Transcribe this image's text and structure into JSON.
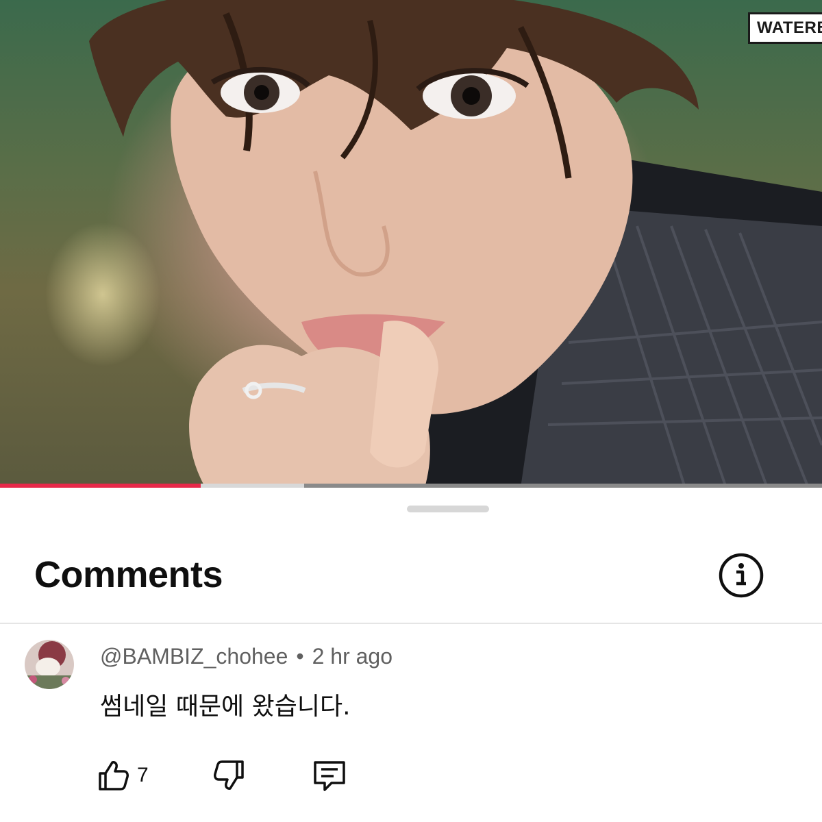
{
  "video": {
    "watermark": "WATERB",
    "progress": {
      "played_fraction": 0.244,
      "buffered_fraction": 0.37
    }
  },
  "comments_panel": {
    "title": "Comments",
    "info_icon": "info-circle-icon"
  },
  "comment": {
    "author": "@BAMBIZ_chohee",
    "separator": "•",
    "time": "2 hr ago",
    "text": "썸네일 때문에 왔습니다.",
    "like_count": "7",
    "icons": {
      "like": "thumbs-up-icon",
      "dislike": "thumbs-down-icon",
      "reply": "comment-reply-icon"
    }
  },
  "colors": {
    "progress_played": "#e8294a",
    "progress_buffer": "#d8d8d8",
    "text_primary": "#0f0f0f",
    "text_secondary": "#606060"
  }
}
